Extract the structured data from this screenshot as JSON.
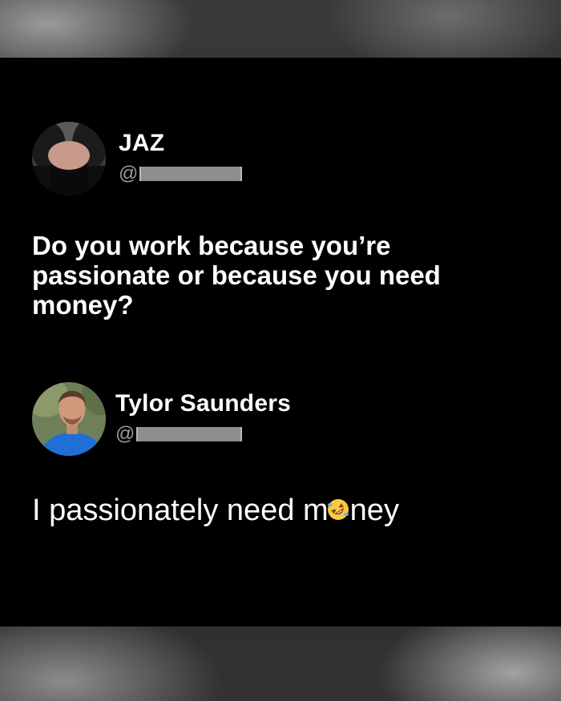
{
  "posts": [
    {
      "name": "JAZ",
      "handle_prefix": "@",
      "text": "Do you work because you’re passionate or because you need money?"
    },
    {
      "name": "Tylor Saunders",
      "handle_prefix": "@",
      "text_before": "I passionately need m",
      "emoji": "rolling-on-floor-laughing-icon",
      "text_after": "ney"
    }
  ]
}
